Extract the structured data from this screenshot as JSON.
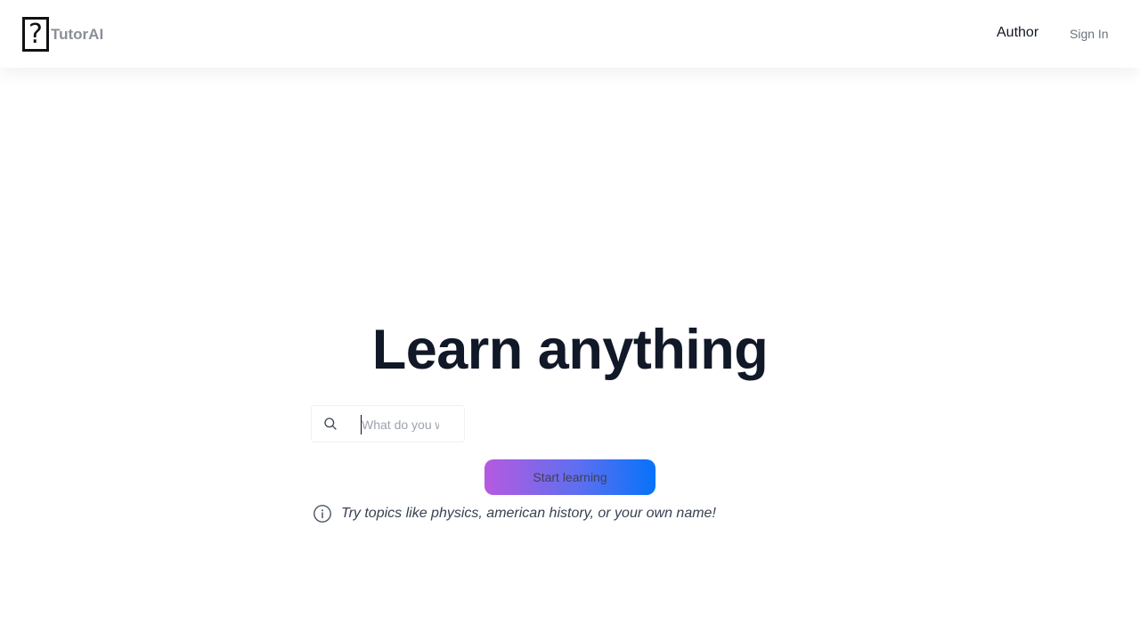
{
  "navbar": {
    "brand": "TutorAI",
    "logo_glyph": "?",
    "author_label": "Author",
    "signin_label": "Sign In"
  },
  "hero": {
    "title": "Learn anything"
  },
  "search": {
    "placeholder": "What do you want to learn?",
    "value": "",
    "icon": "search-icon"
  },
  "cta": {
    "start_label": "Start learning",
    "gradient_start": "#b65ae0",
    "gradient_end": "#0673fa"
  },
  "hint": {
    "icon": "info-icon",
    "text": "Try topics like physics, american history, or your own name!"
  },
  "colors": {
    "title": "#111827",
    "brand_text": "#8a8f98",
    "muted": "#6b7280"
  }
}
